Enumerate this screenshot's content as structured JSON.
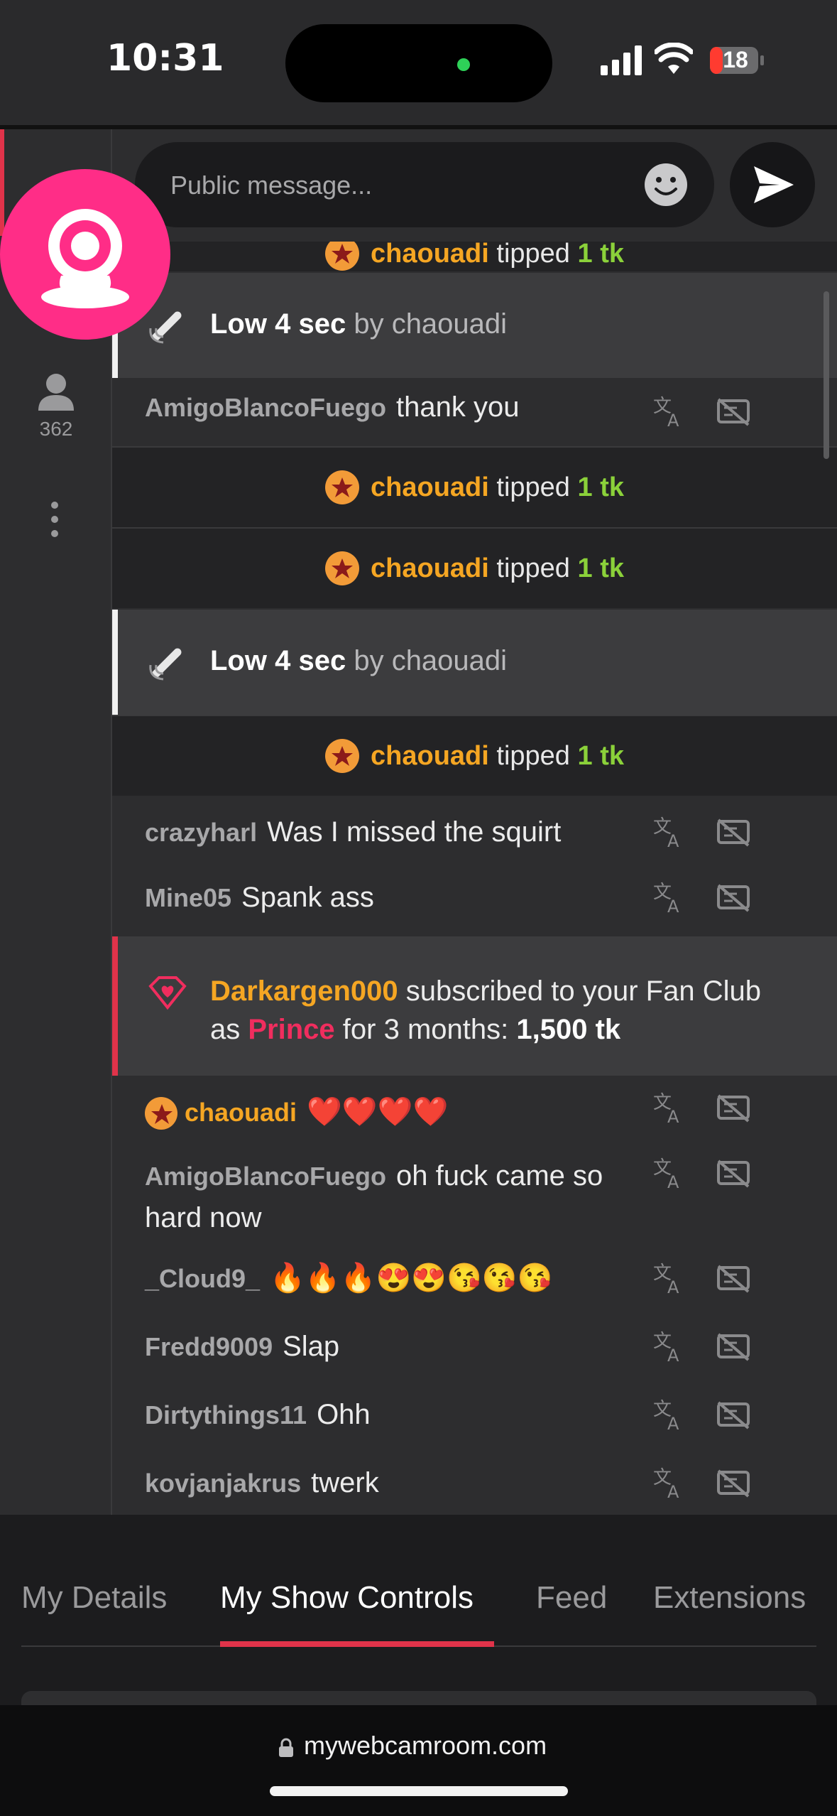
{
  "status_bar": {
    "time": "10:31",
    "battery": "18"
  },
  "sidebar": {
    "viewer_count": "362"
  },
  "message_bar": {
    "placeholder": "Public message..."
  },
  "chat": {
    "partial_tip": {
      "user": "chaouadi",
      "action": "tipped",
      "amount": "1 tk"
    },
    "events": [
      {
        "kind": "toy",
        "strong": "Low 4 sec",
        "by": "by chaouadi"
      },
      {
        "kind": "message",
        "user": "AmigoBlancoFuego",
        "text": "thank you"
      },
      {
        "kind": "tip",
        "user": "chaouadi",
        "action": "tipped",
        "amount": "1 tk"
      },
      {
        "kind": "tip",
        "user": "chaouadi",
        "action": "tipped",
        "amount": "1 tk"
      },
      {
        "kind": "toy",
        "strong": "Low 4 sec",
        "by": "by chaouadi"
      },
      {
        "kind": "tip",
        "user": "chaouadi",
        "action": "tipped",
        "amount": "1 tk"
      },
      {
        "kind": "message",
        "user": "crazyharl",
        "text": "Was I missed the squirt"
      },
      {
        "kind": "message",
        "user": "Mine05",
        "text": "Spank ass"
      },
      {
        "kind": "subscription",
        "user": "Darkargen000",
        "text1": "subscribed to your Fan Club",
        "text2": "as",
        "tier": "Prince",
        "text3": "for 3 months:",
        "amount": "1,500 tk"
      },
      {
        "kind": "message",
        "user": "chaouadi",
        "text": "❤️❤️❤️❤️"
      },
      {
        "kind": "message",
        "user": "AmigoBlancoFuego",
        "text": "oh fuck came so hard now"
      },
      {
        "kind": "message",
        "user": "_Cloud9_",
        "text": "🔥🔥🔥😍😍😘😘😘"
      },
      {
        "kind": "message",
        "user": "Fredd9009",
        "text": "Slap"
      },
      {
        "kind": "message",
        "user": "Dirtythings11",
        "text": "Ohh"
      },
      {
        "kind": "message",
        "user": "kovjanjakrus",
        "text": "twerk"
      }
    ]
  },
  "tabs": [
    {
      "label": "My Details",
      "active": false
    },
    {
      "label": "My Show Controls",
      "active": true
    },
    {
      "label": "Feed",
      "active": false
    },
    {
      "label": "Extensions",
      "active": false
    }
  ],
  "browser": {
    "url": "mywebcamroom.com"
  },
  "colors": {
    "accent_red": "#e0334a",
    "tip_gold": "#f5a623",
    "amount_green": "#8bd13a",
    "fan_pink": "#f02d5e",
    "logo_pink": "#ff2d87"
  }
}
